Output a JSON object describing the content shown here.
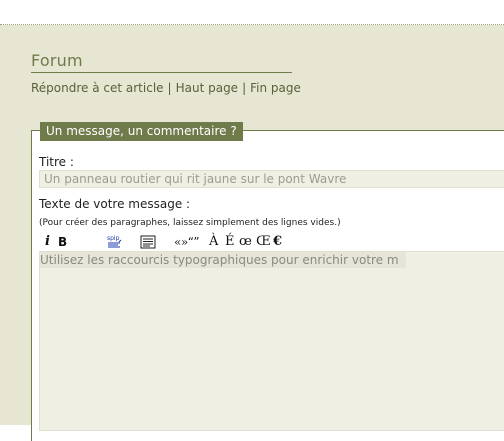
{
  "header": {
    "title": "Forum"
  },
  "links": {
    "reply": "Répondre à cet article",
    "top": "Haut page",
    "bottom": "Fin page",
    "separator": "|"
  },
  "form": {
    "legend": "Un message, un commentaire ?",
    "title_label": "Titre :",
    "title_value": "Un panneau routier qui rit jaune sur le pont Wavre",
    "text_label": "Texte de votre message :",
    "hint": "(Pour créer des paragraphes, laissez simplement des lignes vides.)",
    "textarea_placeholder": "Utilisez les raccourcis typographiques pour enrichir votre m"
  },
  "toolbar": {
    "italic": "i",
    "bold": "B",
    "spip_link_icon": "link-icon",
    "paragraph_icon": "paragraph-icon",
    "quotes": "«»“”",
    "a_grave": "À",
    "e_acute": "É",
    "oe": "œ",
    "OE": "Œ",
    "euro": "€"
  },
  "colors": {
    "background": "#e7e6d2",
    "accent": "#6f7b4b",
    "link": "#57613a",
    "field_bg": "#f0efe4"
  }
}
